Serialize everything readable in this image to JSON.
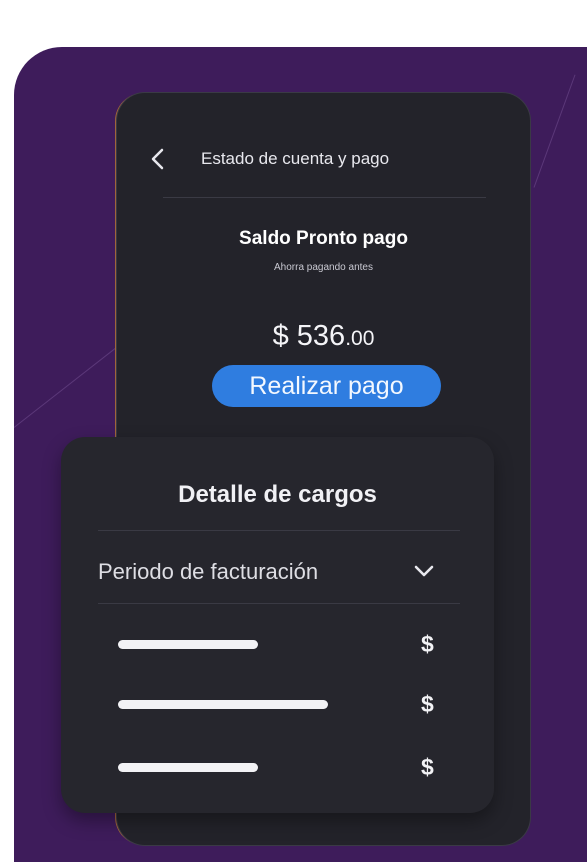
{
  "header": {
    "title": "Estado de cuenta y pago",
    "back_icon": "chevron-left-icon"
  },
  "balance": {
    "title": "Saldo Pronto pago",
    "subtitle": "Ahorra pagando antes",
    "amount_main": "$ 536",
    "amount_cents": ".00",
    "pay_button": "Realizar pago"
  },
  "detail": {
    "title": "Detalle de cargos",
    "period_label": "Periodo de facturación",
    "period_icon": "chevron-down-icon",
    "charges": [
      {
        "symbol": "$"
      },
      {
        "symbol": "$"
      },
      {
        "symbol": "$"
      }
    ]
  },
  "colors": {
    "background": "#3e1c5b",
    "phone": "#23232a",
    "card": "#26262d",
    "accent": "#2f7de0"
  }
}
